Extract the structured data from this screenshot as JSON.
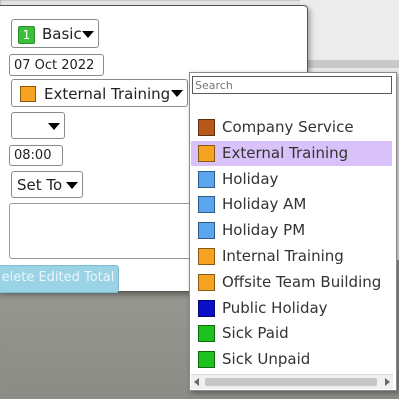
{
  "form": {
    "mode_select": {
      "number": "1",
      "label": "Basic",
      "badge_color": "#3bbf3b"
    },
    "date_value": "07 Oct 2022",
    "type_select": {
      "label": "External Training",
      "color": "#f7a322"
    },
    "empty_select": "",
    "time_value": "08:00",
    "set_to_select": "Set To",
    "notes_value": "",
    "delete_button_label": "elete Edited Total"
  },
  "dropdown": {
    "search_placeholder": "Search",
    "options": [
      {
        "label": "Company Service",
        "color": "#b5581a",
        "selected": false
      },
      {
        "label": "External Training",
        "color": "#f7a322",
        "selected": true
      },
      {
        "label": "Holiday",
        "color": "#5aa7f0",
        "selected": false
      },
      {
        "label": "Holiday AM",
        "color": "#5aa7f0",
        "selected": false
      },
      {
        "label": "Holiday PM",
        "color": "#5aa7f0",
        "selected": false
      },
      {
        "label": "Internal Training",
        "color": "#f7a322",
        "selected": false
      },
      {
        "label": "Offsite Team Building",
        "color": "#f7a322",
        "selected": false
      },
      {
        "label": "Public Holiday",
        "color": "#0a10c8",
        "selected": false
      },
      {
        "label": "Sick Paid",
        "color": "#1ec21e",
        "selected": false
      },
      {
        "label": "Sick Unpaid",
        "color": "#1ec21e",
        "selected": false
      }
    ]
  }
}
